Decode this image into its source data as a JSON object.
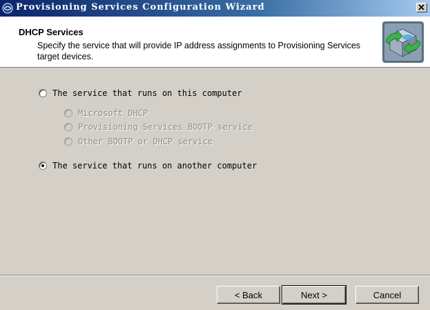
{
  "window": {
    "title": "Provisioning Services Configuration Wizard",
    "close_label": "×"
  },
  "header": {
    "title": "DHCP Services",
    "subtitle": "Specify the service that will provide IP address assignments to Provisioning Services target devices."
  },
  "options": {
    "this_computer": {
      "label": "The service that runs on this computer",
      "checked": false,
      "enabled": true
    },
    "sub_options": [
      {
        "label": "Microsoft DHCP",
        "checked": false,
        "enabled": false
      },
      {
        "label": "Provisioning Services BOOTP service",
        "checked": false,
        "enabled": false
      },
      {
        "label": "Other BOOTP or DHCP service",
        "checked": false,
        "enabled": false
      }
    ],
    "another_computer": {
      "label": "The service that runs on another computer",
      "checked": true,
      "enabled": true
    }
  },
  "buttons": {
    "back": "< Back",
    "next": "Next >",
    "cancel": "Cancel"
  },
  "colors": {
    "titlebar_start": "#0a246a",
    "titlebar_end": "#a6caf0",
    "dialog_bg": "#d4d0c8",
    "header_bg": "#ffffff"
  },
  "icons": {
    "title_icon": "citrix-globe-icon",
    "header_logo": "provisioning-server-icon",
    "close_icon": "close-icon"
  }
}
